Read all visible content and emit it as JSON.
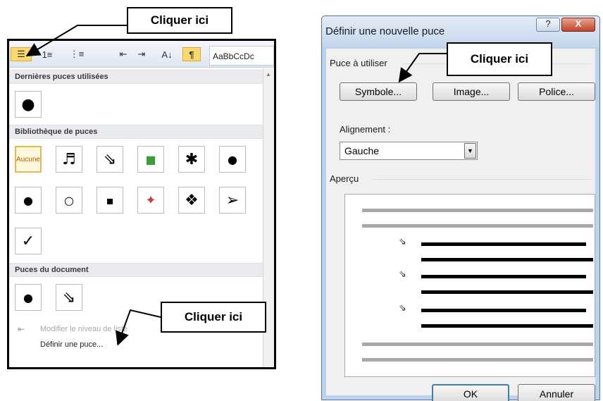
{
  "callouts": [
    {
      "text": "Cliquer ici"
    },
    {
      "text": "Cliquer ici"
    },
    {
      "text": "Cliquer ici"
    }
  ],
  "left_panel": {
    "toolbar": {
      "style_preview": "AaBbCcDc",
      "pilcrow": "¶",
      "bullets_glyph": "☰",
      "numbering_glyph": "1≡",
      "multilevel_glyph": "⋮≡",
      "decrease_indent_glyph": "⇤",
      "increase_indent_glyph": "⇥",
      "sort_glyph": "A↓"
    },
    "recent_header": "Dernières puces utilisées",
    "recent_bullets": [
      "●"
    ],
    "library_header": "Bibliothèque de puces",
    "library_bullets": [
      "Aucune",
      "♬",
      "⇘",
      "■",
      "✱",
      "●",
      "●",
      "○",
      "▪",
      "✦",
      "❖",
      "➢",
      "✓"
    ],
    "document_header": "Puces du document",
    "document_bullets": [
      "●",
      "⇘"
    ],
    "menu_items": [
      {
        "label": "Modifier le niveau de liste",
        "icon": "⇤"
      },
      {
        "label": "Définir une puce...",
        "icon": ""
      }
    ]
  },
  "dialog": {
    "title": "Définir une nouvelle puce",
    "help_label": "?",
    "close_label": "X",
    "group_bullet": "Puce à utiliser",
    "btn_symbol": "Symbole...",
    "btn_image": "Image...",
    "btn_police": "Police...",
    "alignment_label": "Alignement :",
    "alignment_value": "Gauche",
    "dropdown_glyph": "▼",
    "group_preview": "Aperçu",
    "preview_bullet": "⇘",
    "ok_label": "OK",
    "cancel_label": "Annuler"
  },
  "colors": {
    "accent_yellow": "#fbd96b",
    "selected_border": "#e5b94a",
    "dialog_frame": "#bcd1ea",
    "close_red": "#c1442a"
  }
}
